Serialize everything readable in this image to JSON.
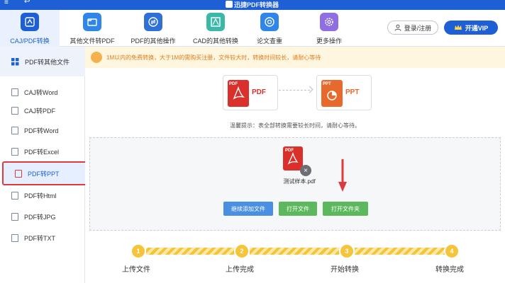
{
  "app": {
    "title": "迅捷PDF转换器"
  },
  "tabs": [
    {
      "label": "CAJ/PDF转换",
      "active": true,
      "color": "#1f5fd6"
    },
    {
      "label": "其他文件转PDF",
      "active": false,
      "color": "#2f86e8"
    },
    {
      "label": "PDF的其他操作",
      "active": false,
      "color": "#2f6fd8"
    },
    {
      "label": "CAD的其他转换",
      "active": false,
      "color": "#3bb8a8"
    },
    {
      "label": "论文查重",
      "active": false,
      "color": "#2f86e8"
    },
    {
      "label": "更多操作",
      "active": false,
      "color": "#8f6fe0"
    }
  ],
  "account": {
    "login_label": "登录/注册",
    "vip_label": "开通VIP"
  },
  "sidebar": {
    "header": "PDF转其他文件",
    "items": [
      {
        "label": "CAJ转Word"
      },
      {
        "label": "CAJ转PDF"
      },
      {
        "label": "PDF转Word"
      },
      {
        "label": "PDF转Excel"
      },
      {
        "label": "PDF转PPT",
        "active": true
      },
      {
        "label": "PDF转Html"
      },
      {
        "label": "PDF转JPG"
      },
      {
        "label": "PDF转TXT"
      }
    ]
  },
  "notice": {
    "text": "1M以内的免费转换，大于1M的需购买注册，文件较大时，转换时间较长，请耐心等待"
  },
  "conversion": {
    "source": {
      "tag": "PDF",
      "label": "PDF",
      "color": "#d9302c"
    },
    "target": {
      "tag": "PPT",
      "label": "PPT",
      "color": "#e8692c"
    },
    "tip": "温馨提示：表全部转换需要较长时间，请耐心等待。"
  },
  "file": {
    "tag": "PDF",
    "name": "测试样本.pdf"
  },
  "buttons": {
    "add_label": "继续添加文件",
    "open_label": "打开文件",
    "folder_label": "打开文件夹"
  },
  "steps": [
    {
      "number": "1",
      "label": "上传文件"
    },
    {
      "number": "2",
      "label": "上传完成"
    },
    {
      "number": "3",
      "label": "开始转换"
    },
    {
      "number": "4",
      "label": "转换完成"
    }
  ]
}
